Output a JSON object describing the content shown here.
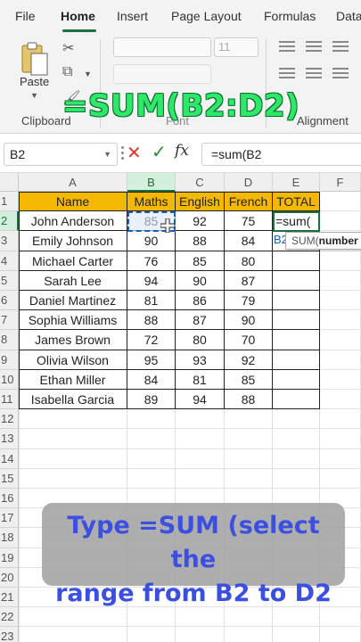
{
  "ribbon": {
    "tabs": [
      {
        "label": "File"
      },
      {
        "label": "Home"
      },
      {
        "label": "Insert"
      },
      {
        "label": "Page Layout"
      },
      {
        "label": "Formulas"
      },
      {
        "label": "Data"
      }
    ],
    "active_tab": "Home",
    "paste_label": "Paste",
    "clipboard_label": "Clipboard",
    "font_label": "Font",
    "alignment_label": "Alignment",
    "font_size": "11"
  },
  "overlay_formula": "=SUM(B2:D2)",
  "formula_bar": {
    "name_box": "B2",
    "content": "=sum(B2"
  },
  "sheet": {
    "columns": [
      "A",
      "B",
      "C",
      "D",
      "E",
      "F"
    ],
    "rows": [
      "1",
      "2",
      "3",
      "4",
      "5",
      "6",
      "7",
      "8",
      "9",
      "10",
      "11",
      "12",
      "13",
      "14",
      "15",
      "16",
      "17",
      "18",
      "19",
      "20",
      "21",
      "22",
      "23"
    ],
    "headers": [
      "Name",
      "Maths",
      "English",
      "French",
      "TOTAL"
    ],
    "data": [
      [
        "John Anderson",
        "85",
        "92",
        "75"
      ],
      [
        "Emily Johnson",
        "90",
        "88",
        "84"
      ],
      [
        "Michael Carter",
        "76",
        "85",
        "80"
      ],
      [
        "Sarah Lee",
        "94",
        "90",
        "87"
      ],
      [
        "Daniel Martinez",
        "81",
        "86",
        "79"
      ],
      [
        "Sophia Williams",
        "88",
        "87",
        "90"
      ],
      [
        "James Brown",
        "72",
        "80",
        "70"
      ],
      [
        "Olivia Wilson",
        "95",
        "93",
        "92"
      ],
      [
        "Ethan Miller",
        "84",
        "81",
        "85"
      ],
      [
        "Isabella Garcia",
        "89",
        "94",
        "88"
      ]
    ],
    "active_cell_text": "=sum(",
    "tooltip_fn": "SUM(",
    "tooltip_arg": "number",
    "ref_hint": "B2"
  },
  "caption": {
    "line1": "Type  =SUM (select the",
    "line2": "range from B2 to D2"
  },
  "colors": {
    "header_fill": "#f5b800",
    "accent": "#1e6e42",
    "overlay_green": "#2ee86a",
    "caption_text": "#3b4fe0"
  }
}
